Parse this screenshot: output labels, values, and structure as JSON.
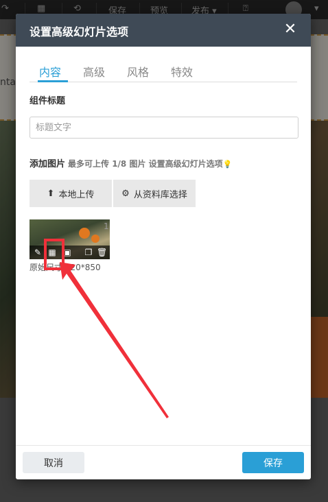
{
  "topbar": {
    "save_label": "保存",
    "preview_label": "预览",
    "publish_label": "发布"
  },
  "background": {
    "ghost_text": "nta"
  },
  "modal": {
    "title": "设置高级幻灯片选项",
    "tabs": [
      {
        "label": "内容",
        "active": true
      },
      {
        "label": "高级",
        "active": false
      },
      {
        "label": "风格",
        "active": false
      },
      {
        "label": "特效",
        "active": false
      }
    ],
    "component_title_label": "组件标题",
    "title_input": {
      "value": "",
      "placeholder": "标题文字"
    },
    "add_image_label": "添加图片",
    "add_image_hint": "最多可上传 1/8 图片 设置高级幻灯片选项",
    "upload_local_label": "本地上传",
    "choose_library_label": "从资料库选择",
    "thumbnail": {
      "index": "1",
      "size_text": "原始尺寸 920*850"
    },
    "cancel_label": "取消",
    "save_label": "保存"
  },
  "colors": {
    "accent": "#2a9fd6",
    "header": "#3f4a56",
    "annotation": "#f0303a"
  }
}
